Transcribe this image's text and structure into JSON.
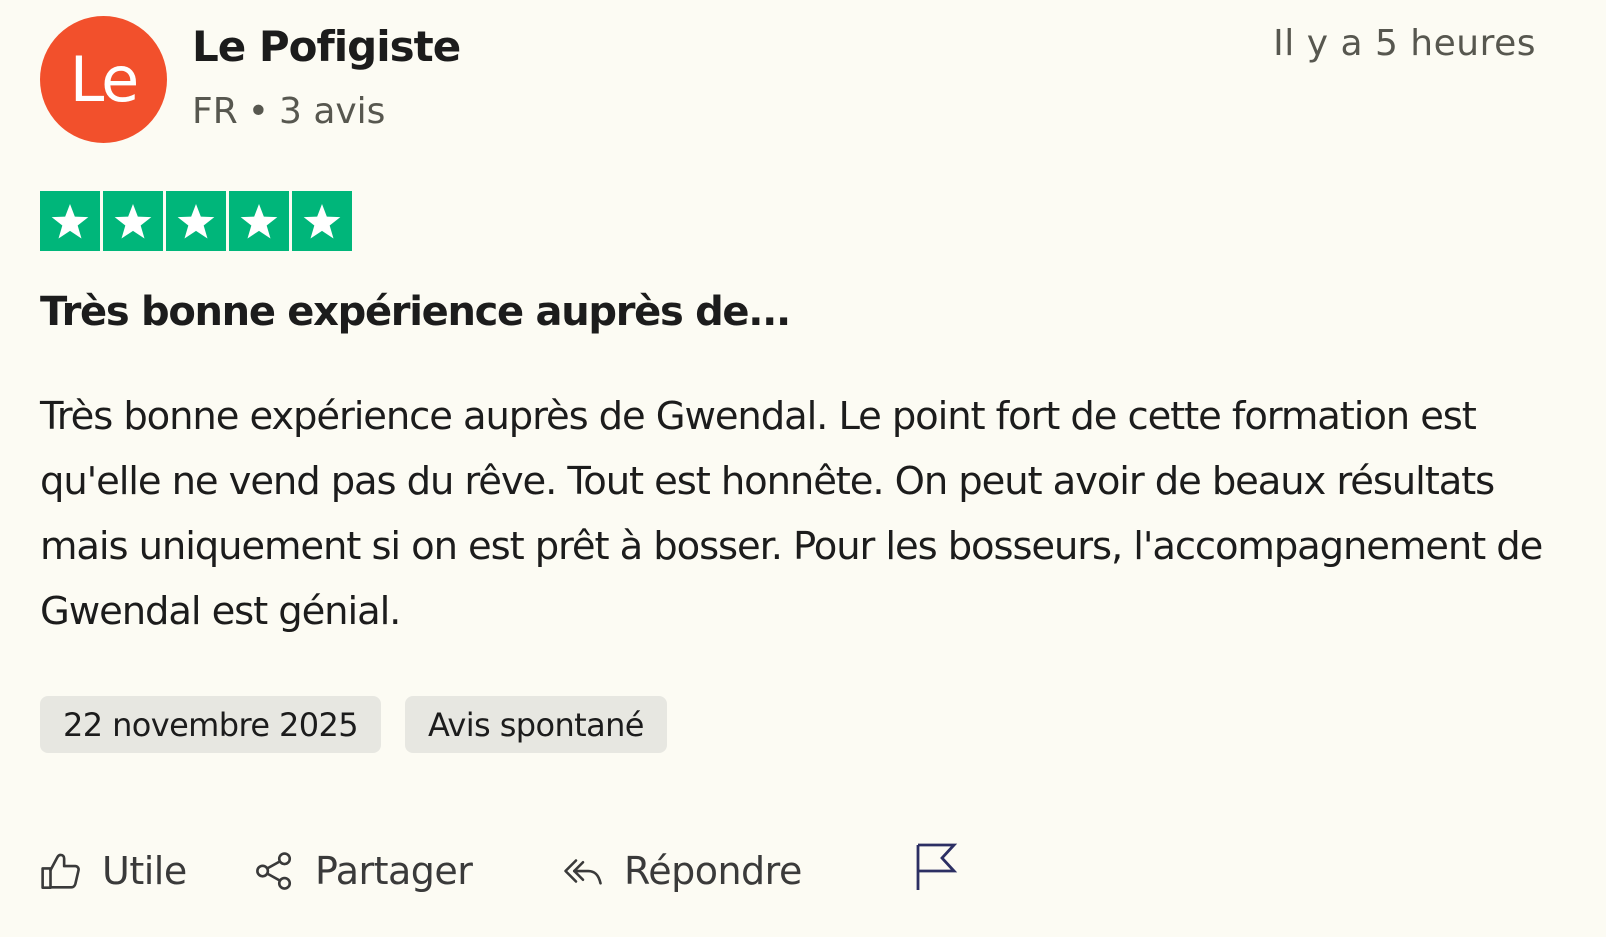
{
  "reviewer": {
    "avatar_initials": "Le",
    "avatar_color": "#f2502c",
    "name": "Le Pofigiste",
    "country": "FR",
    "separator": "•",
    "review_count": "3 avis"
  },
  "relative_time": "Il y a 5 heures",
  "rating": {
    "value": 5,
    "max": 5,
    "star_color": "#00b67a"
  },
  "review": {
    "title": "Très bonne expérience auprès de...",
    "body": "Très bonne expérience auprès de Gwendal. Le point fort de cette formation est qu'elle ne vend pas du rêve. Tout est honnête. On peut avoir de beaux résultats mais uniquement si on est prêt à bosser. Pour les bosseurs, l'accompagnement de Gwendal est génial."
  },
  "tags": {
    "date": "22 novembre 2025",
    "type": "Avis spontané"
  },
  "actions": {
    "useful": {
      "label": "Utile",
      "icon": "thumbs-up-icon"
    },
    "share": {
      "label": "Partager",
      "icon": "share-icon"
    },
    "reply": {
      "label": "Répondre",
      "icon": "reply-icon"
    },
    "report": {
      "icon": "flag-icon"
    }
  }
}
